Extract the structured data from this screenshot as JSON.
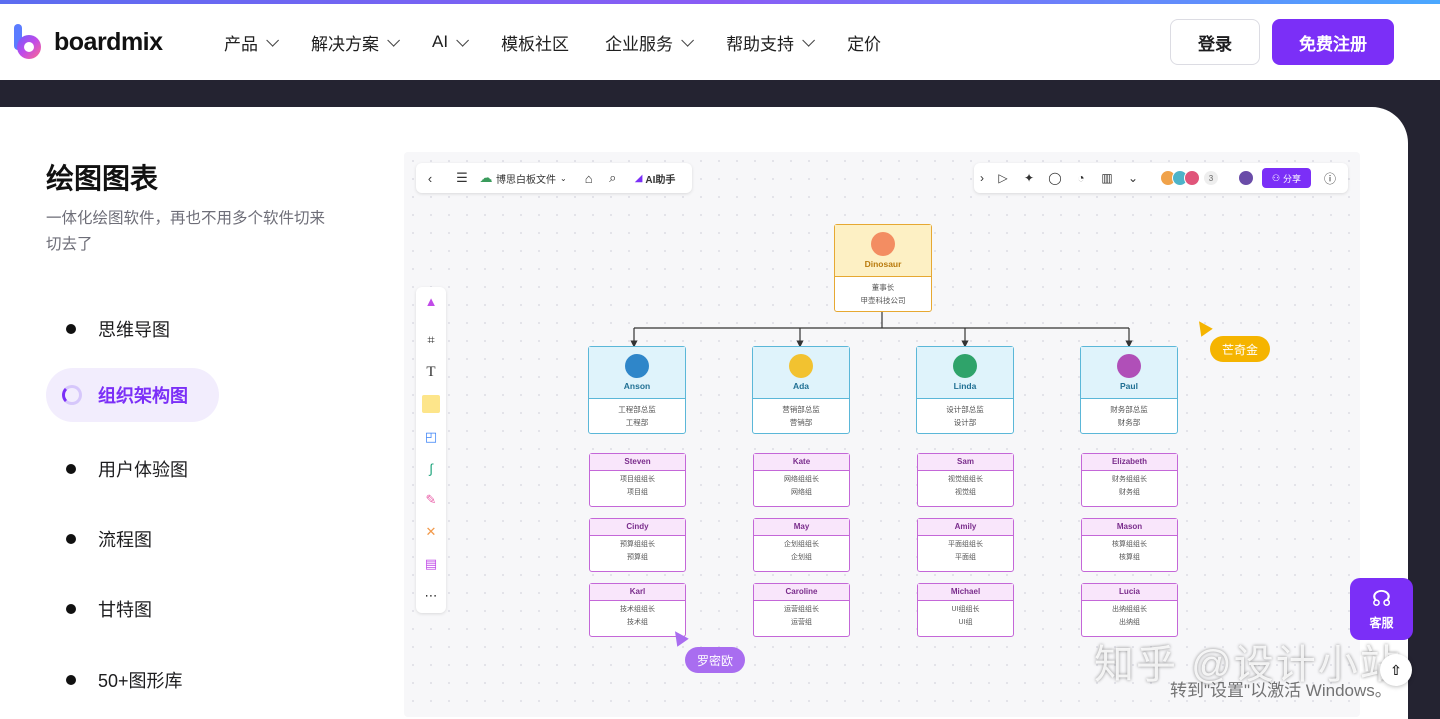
{
  "brand": {
    "name": "boardmix"
  },
  "nav": {
    "items": [
      {
        "label": "产品",
        "has_dropdown": true
      },
      {
        "label": "解决方案",
        "has_dropdown": true
      },
      {
        "label": "AI",
        "has_dropdown": true
      },
      {
        "label": "模板社区",
        "has_dropdown": false
      },
      {
        "label": "企业服务",
        "has_dropdown": true
      },
      {
        "label": "帮助支持",
        "has_dropdown": true
      },
      {
        "label": "定价",
        "has_dropdown": false
      }
    ],
    "login_label": "登录",
    "signup_label": "免费注册"
  },
  "section": {
    "title": "绘图图表",
    "description": "一体化绘图软件，再也不用多个软件切来切去了",
    "features": [
      "思维导图",
      "组织架构图",
      "用户体验图",
      "流程图",
      "甘特图",
      "50+图形库"
    ],
    "active_feature": "组织架构图"
  },
  "board": {
    "file_name": "博思白板文件",
    "ai_label": "AI助手",
    "collaborator_count": "3",
    "share_label": "分享",
    "root": {
      "name": "Dinosaur",
      "title": "董事长",
      "dept": "甲壶科技公司"
    },
    "managers": [
      {
        "name": "Anson",
        "title": "工程部总监",
        "dept": "工程部"
      },
      {
        "name": "Ada",
        "title": "营销部总监",
        "dept": "营销部"
      },
      {
        "name": "Linda",
        "title": "设计部总监",
        "dept": "设计部"
      },
      {
        "name": "Paul",
        "title": "财务部总监",
        "dept": "财务部"
      }
    ],
    "teams": [
      [
        {
          "name": "Steven",
          "title": "项目组组长",
          "dept": "项目组"
        },
        {
          "name": "Cindy",
          "title": "预算组组长",
          "dept": "预算组"
        },
        {
          "name": "Karl",
          "title": "技术组组长",
          "dept": "技术组"
        }
      ],
      [
        {
          "name": "Kate",
          "title": "网络组组长",
          "dept": "网络组"
        },
        {
          "name": "May",
          "title": "企划组组长",
          "dept": "企划组"
        },
        {
          "name": "Caroline",
          "title": "运营组组长",
          "dept": "运营组"
        }
      ],
      [
        {
          "name": "Sam",
          "title": "视觉组组长",
          "dept": "视觉组"
        },
        {
          "name": "Amily",
          "title": "平面组组长",
          "dept": "平面组"
        },
        {
          "name": "Michael",
          "title": "UI组组长",
          "dept": "UI组"
        }
      ],
      [
        {
          "name": "Elizabeth",
          "title": "财务组组长",
          "dept": "财务组"
        },
        {
          "name": "Mason",
          "title": "核算组组长",
          "dept": "核算组"
        },
        {
          "name": "Lucia",
          "title": "出纳组组长",
          "dept": "出纳组"
        }
      ]
    ],
    "cursors": [
      {
        "name": "芒奇金",
        "color": "#f5b400"
      },
      {
        "name": "罗密欧",
        "color": "#a96df0"
      }
    ]
  },
  "widgets": {
    "support_label": "客服",
    "watermark_main": "知乎 @设计小站",
    "watermark_activation": "转到\"设置\"以激活 Windows。"
  },
  "colors": {
    "brand_purple": "#7b2ff7",
    "root_fill": "#fdf0c4",
    "root_border": "#e6a832",
    "manager_fill": "#dff3fb",
    "manager_border": "#5bb7d8",
    "team_border": "#c467d8"
  }
}
